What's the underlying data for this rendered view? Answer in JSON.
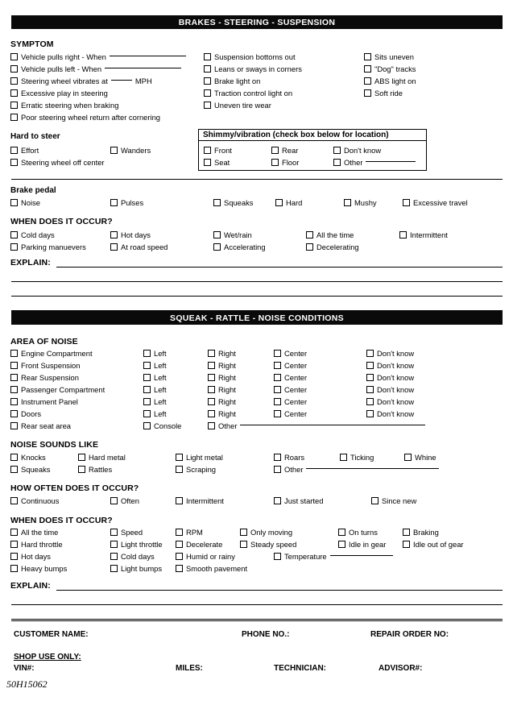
{
  "document": {
    "id": "50H15062"
  },
  "bands": {
    "brakes": "BRAKES - STEERING - SUSPENSION",
    "squeak": "SQUEAK - RATTLE - NOISE CONDITIONS"
  },
  "symptom": {
    "heading": "SYMPTOM",
    "col1": [
      "Vehicle pulls right - When",
      "Vehicle pulls left - When",
      "Steering wheel vibrates at",
      "Excessive play in steering",
      "Erratic steering when braking",
      "Poor steering wheel return after cornering"
    ],
    "mph_suffix": "MPH",
    "col2": [
      "Suspension bottoms out",
      "Leans or sways in corners",
      "Brake light on",
      "Traction control light on",
      "Uneven tire wear"
    ],
    "col3": [
      "Sits uneven",
      "\"Dog\" tracks",
      "ABS light on",
      "Soft ride"
    ]
  },
  "hard_to_steer": {
    "heading": "Hard to steer",
    "items": [
      "Effort",
      "Wanders",
      "Steering wheel off center"
    ]
  },
  "shimmy": {
    "title": "Shimmy/vibration (check box below for location)",
    "row1": [
      "Front",
      "Rear",
      "Don't know"
    ],
    "row2": [
      "Seat",
      "Floor",
      "Other"
    ]
  },
  "brake_pedal": {
    "heading": "Brake pedal",
    "items": [
      "Noise",
      "Pulses",
      "Squeaks",
      "Hard",
      "Mushy",
      "Excessive travel"
    ]
  },
  "when_occur_1": {
    "heading": "WHEN DOES IT OCCUR?",
    "row1": [
      "Cold days",
      "Hot days",
      "Wet/rain",
      "All the time",
      "Intermittent"
    ],
    "row2": [
      "Parking manuevers",
      "At road speed",
      "Accelerating",
      "Decelerating"
    ]
  },
  "explain_1": {
    "label": "EXPLAIN:"
  },
  "area_of_noise": {
    "heading": "AREA OF NOISE",
    "rows": [
      {
        "area": "Engine Compartment",
        "left": "Left",
        "right": "Right",
        "center": "Center",
        "dontknow": "Don't know"
      },
      {
        "area": "Front Suspension",
        "left": "Left",
        "right": "Right",
        "center": "Center",
        "dontknow": "Don't know"
      },
      {
        "area": "Rear Suspension",
        "left": "Left",
        "right": "Right",
        "center": "Center",
        "dontknow": "Don't know"
      },
      {
        "area": "Passenger Compartment",
        "left": "Left",
        "right": "Right",
        "center": "Center",
        "dontknow": "Don't know"
      },
      {
        "area": "Instrument Panel",
        "left": "Left",
        "right": "Right",
        "center": "Center",
        "dontknow": "Don't know"
      },
      {
        "area": "Doors",
        "left": "Left",
        "right": "Right",
        "center": "Center",
        "dontknow": "Don't know"
      }
    ],
    "last_row": {
      "area": "Rear seat area",
      "console": "Console",
      "other": "Other"
    }
  },
  "noise_sounds_like": {
    "heading": "NOISE SOUNDS LIKE",
    "row1": [
      "Knocks",
      "Hard metal",
      "Light metal",
      "Roars",
      "Ticking",
      "Whine"
    ],
    "row2": [
      "Squeaks",
      "Rattles",
      "Scraping",
      "Other"
    ]
  },
  "how_often": {
    "heading": "HOW OFTEN DOES IT OCCUR?",
    "items": [
      "Continuous",
      "Often",
      "Intermittent",
      "Just started",
      "Since new"
    ]
  },
  "when_occur_2": {
    "heading": "WHEN DOES IT OCCUR?",
    "row1": [
      "All the time",
      "Speed",
      "RPM",
      "Only moving",
      "On turns",
      "Braking"
    ],
    "row2": [
      "Hard throttle",
      "Light throttle",
      "Decelerate",
      "Steady speed",
      "Idle in gear",
      "Idle out of gear"
    ],
    "row3": [
      "Hot days",
      "Cold days",
      "Humid or rainy",
      "Temperature"
    ],
    "row4": [
      "Heavy bumps",
      "Light bumps",
      "Smooth pavement"
    ]
  },
  "explain_2": {
    "label": "EXPLAIN:"
  },
  "footer": {
    "customer_name": "CUSTOMER NAME:",
    "phone_no": "PHONE NO.:",
    "repair_order_no": "REPAIR ORDER NO:",
    "shop_use_only": "SHOP USE ONLY:",
    "vin": "VIN#:",
    "miles": "MILES:",
    "technician": "TECHNICIAN:",
    "advisor": "ADVISOR#:"
  }
}
